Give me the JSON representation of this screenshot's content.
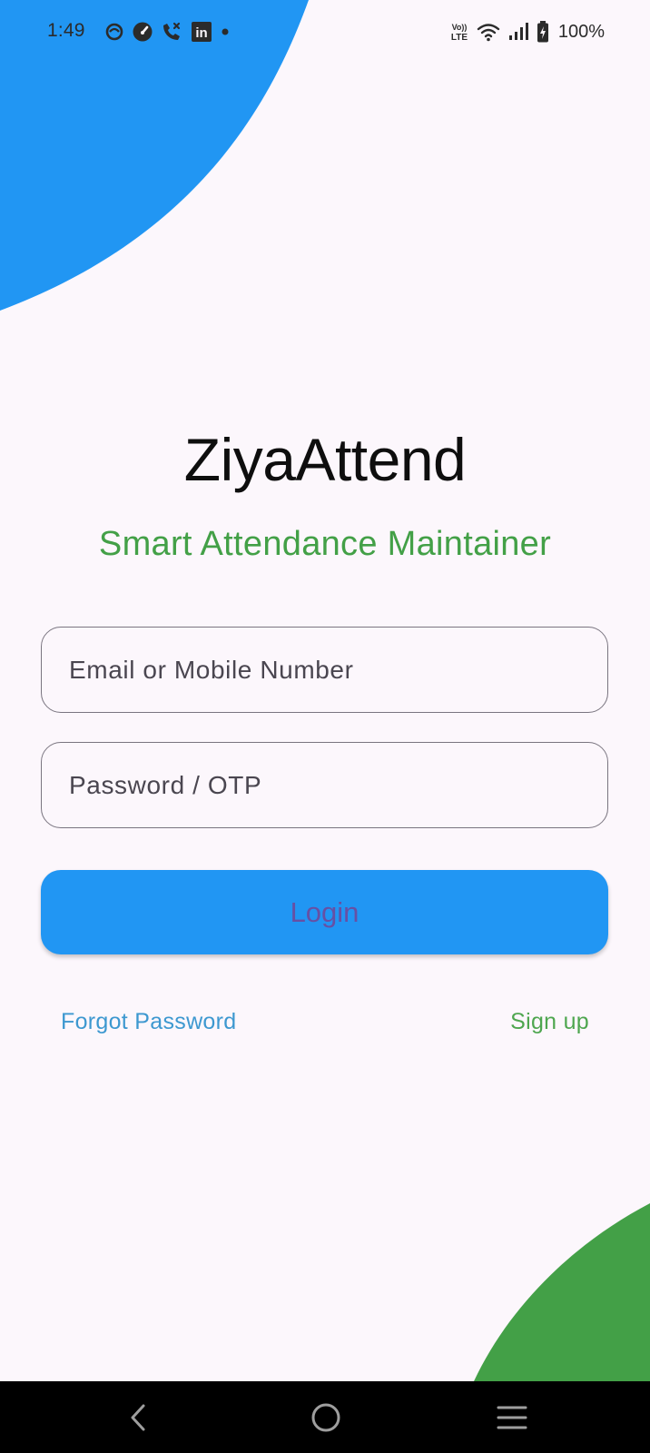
{
  "status_bar": {
    "time": "1:49",
    "notification_icons": [
      "app-circle-icon",
      "gauge-icon",
      "missed-call-icon",
      "linkedin-icon",
      "more-dot-icon"
    ],
    "system_icons": [
      "volte-icon",
      "wifi-icon",
      "signal-icon",
      "battery-charging-icon"
    ],
    "volte_label_top": "Vo))",
    "volte_label_bottom": "LTE",
    "linkedin_label": "in",
    "battery": "100%"
  },
  "app": {
    "title": "ZiyaAttend",
    "subtitle": "Smart Attendance Maintainer"
  },
  "form": {
    "email_placeholder": "Email or Mobile Number",
    "email_value": "",
    "password_placeholder": "Password / OTP",
    "password_value": "",
    "login_label": "Login"
  },
  "links": {
    "forgot_password": "Forgot Password",
    "sign_up": "Sign up"
  },
  "navigation": {
    "buttons": [
      "back-icon",
      "home-icon",
      "recents-icon"
    ]
  },
  "colors": {
    "accent_blue": "#2196f3",
    "accent_green": "#43a047",
    "background": "#fcf7fc",
    "login_text": "#6750a4",
    "forgot_link": "#3d98d0",
    "signup_link": "#4ea64f"
  }
}
